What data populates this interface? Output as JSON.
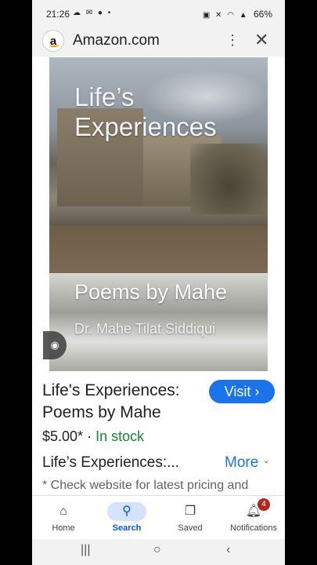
{
  "status_bar": {
    "time": "21:26",
    "left_icons": "☁ ✉ ● •",
    "right_icons": "▣ ✕ ◠ ▲",
    "battery": "66%"
  },
  "browser": {
    "site_title": "Amazon.com",
    "logo_letter": "a",
    "menu_glyph": "⋮",
    "close_glyph": "✕"
  },
  "cover": {
    "title": "Life’s Experiences",
    "subtitle": "Poems by Mahe",
    "author": "Dr. Mahe Tilat Siddiqui"
  },
  "product": {
    "title": "Life's Experiences: Poems by Mahe",
    "visit_label": "Visit ›",
    "price": "$5.00*",
    "separator": " · ",
    "stock": "In stock",
    "description_short": "Life’s Experiences:...",
    "more_label": "More",
    "disclaimer": "* Check website for latest pricing and"
  },
  "bottom_nav": {
    "items": [
      {
        "label": "Home",
        "icon": "home-icon",
        "glyph": "⌂"
      },
      {
        "label": "Search",
        "icon": "search-icon",
        "glyph": "⚲"
      },
      {
        "label": "Saved",
        "icon": "bookmark-icon",
        "glyph": "❐"
      },
      {
        "label": "Notifications",
        "icon": "bell-icon",
        "glyph": "🔔︎",
        "badge": "4"
      }
    ],
    "active": "Search"
  },
  "system_nav": {
    "recents": "|||",
    "home": "○",
    "back": "‹"
  },
  "colors": {
    "accent": "#1a73e8",
    "stock_green": "#188038",
    "active_pill": "#d3e3fd",
    "badge_red": "#b3261e"
  }
}
